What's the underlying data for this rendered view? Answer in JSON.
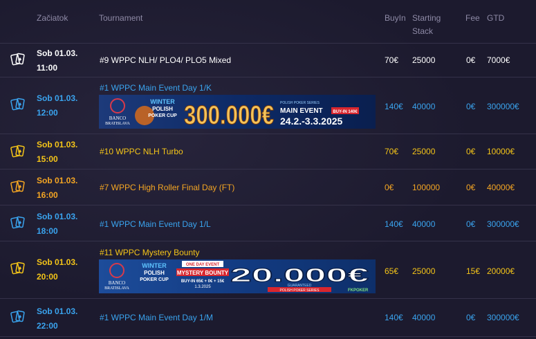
{
  "header": {
    "start": "Začiatok",
    "tournament": "Tournament",
    "buyin": "BuyIn",
    "starting_line1": "Starting",
    "starting_line2": "Stack",
    "fee": "Fee",
    "gtd": "GTD"
  },
  "rows": [
    {
      "date": "Sob 01.03.",
      "time": "11:00",
      "title": "#9 WPPC NLH/ PLO4/ PLO5 Mixed",
      "buyin": "70€",
      "stack": "25000",
      "fee": "0€",
      "gtd": "7000€",
      "color": "#ffffff"
    },
    {
      "date": "Sob 01.03.",
      "time": "12:00",
      "title": "#1 WPPC Main Event Day 1/K",
      "buyin": "140€",
      "stack": "40000",
      "fee": "0€",
      "gtd": "300000€",
      "color": "#3aa4ef"
    },
    {
      "date": "Sob 01.03.",
      "time": "15:00",
      "title": "#10 WPPC NLH Turbo",
      "buyin": "70€",
      "stack": "25000",
      "fee": "0€",
      "gtd": "10000€",
      "color": "#f5c518"
    },
    {
      "date": "Sob 01.03.",
      "time": "16:00",
      "title": "#7 WPPC High Roller Final Day (FT)",
      "buyin": "0€",
      "stack": "100000",
      "fee": "0€",
      "gtd": "40000€",
      "color": "#f5a623"
    },
    {
      "date": "Sob 01.03.",
      "time": "18:00",
      "title": "#1 WPPC Main Event Day 1/L",
      "buyin": "140€",
      "stack": "40000",
      "fee": "0€",
      "gtd": "300000€",
      "color": "#3aa4ef"
    },
    {
      "date": "Sob 01.03.",
      "time": "20:00",
      "title": "#11 WPPC Mystery Bounty",
      "buyin": "65€",
      "stack": "25000",
      "fee": "15€",
      "gtd": "20000€",
      "color": "#f5c518"
    },
    {
      "date": "Sob 01.03.",
      "time": "22:00",
      "title": "#1 WPPC Main Event Day 1/M",
      "buyin": "140€",
      "stack": "40000",
      "fee": "0€",
      "gtd": "300000€",
      "color": "#3aa4ef"
    }
  ],
  "banner1": {
    "brand1": "BANCO",
    "brand2": "BRATISLAVA",
    "w1": "WINTER",
    "w2": "POLISH",
    "w3": "POKER CUP",
    "amount": "300.000€",
    "event": "MAIN EVENT",
    "buyin": "BUY-IN 140€",
    "dates": "24.2.-3.3.2025",
    "series": "POLISH POKER SERIES"
  },
  "banner2": {
    "brand1": "BANCO",
    "brand2": "BRATISLAVA",
    "w1": "WINTER",
    "w2": "POLISH",
    "w3": "POKER CUP",
    "tag": "ONE DAY EVENT",
    "event": "MYSTERY BOUNTY",
    "buyin": "BUY-IN 65€ + 0€ + 15€",
    "date": "1.3.2025",
    "amount": "20.000€",
    "guaranteed": "GUARANTEED",
    "series": "POLISH POKER SERIES",
    "partner": "FKPOKER"
  }
}
